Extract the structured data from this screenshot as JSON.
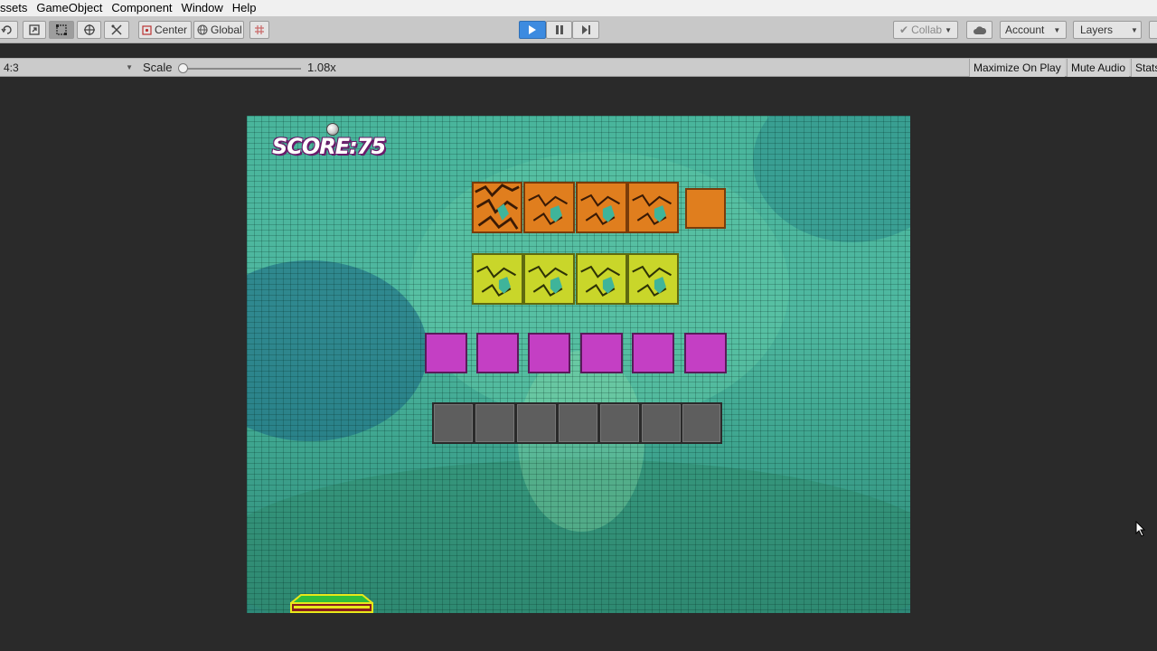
{
  "menu": {
    "items": [
      "ssets",
      "GameObject",
      "Component",
      "Window",
      "Help"
    ]
  },
  "toolbar": {
    "tools": [
      {
        "name": "rotate-tool-icon"
      },
      {
        "name": "scale-tool-icon"
      },
      {
        "name": "rect-tool-icon"
      },
      {
        "name": "transform-tool-icon"
      },
      {
        "name": "custom-tool-icon"
      }
    ],
    "pivot_label": "Center",
    "space_label": "Global",
    "collab_label": "Collab",
    "account_label": "Account",
    "layers_label": "Layers"
  },
  "gamebar": {
    "aspect": "4:3",
    "scale_label": "Scale",
    "scale_value": "1.08x",
    "maximize_label": "Maximize On Play",
    "mute_label": "Mute Audio",
    "stats_label": "Stats"
  },
  "game": {
    "score_text": "SCORE:75",
    "brick_rows": [
      {
        "color": "orange",
        "count": 5,
        "cracked": 4
      },
      {
        "color": "yellow",
        "count": 4,
        "cracked": 4
      },
      {
        "color": "magenta",
        "count": 6,
        "cracked": 0
      },
      {
        "color": "gray",
        "count": 7,
        "cracked": 0
      }
    ]
  },
  "colors": {
    "play_accent": "#3d8be0",
    "background": "#2a2a2a",
    "orange_brick": "#e07e1e",
    "yellow_brick": "#c9d62a",
    "magenta_brick": "#c43fc4",
    "gray_brick": "#5e5e5e"
  }
}
